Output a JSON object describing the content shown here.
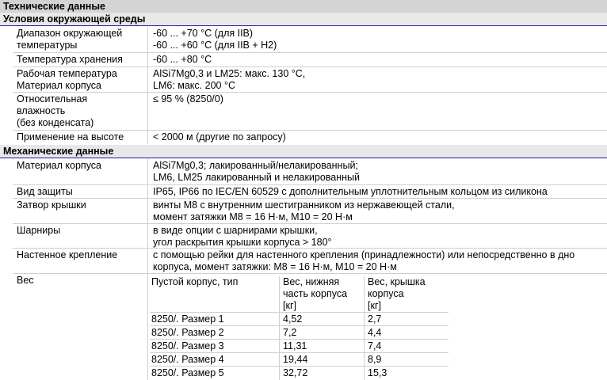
{
  "title": "Технические данные",
  "sections": {
    "env": {
      "header": "Условия окружающей среды",
      "rows": [
        {
          "label": [
            "Диапазон окружающей",
            "температуры"
          ],
          "value": [
            "-60 ... +70 °C (для IIB)",
            "-60 ... +60 °C (для IIB + H2)"
          ]
        },
        {
          "label": [
            "Температура хранения"
          ],
          "value": [
            "-60 ... +80 °C"
          ]
        },
        {
          "label": [
            "Рабочая температура",
            "Материал корпуса"
          ],
          "value": [
            "AlSi7Mg0,3 и LM25: макс. 130 °C,",
            "LM6: макс. 200 °C"
          ]
        },
        {
          "label": [
            "Относительная",
            "влажность",
            "(без конденсата)"
          ],
          "value": [
            "≤ 95 % (8250/0)"
          ]
        },
        {
          "label": [
            "Применение на высоте"
          ],
          "value": [
            "< 2000 м (другие по запросу)"
          ]
        }
      ]
    },
    "mech": {
      "header": "Механические данные",
      "rows": [
        {
          "label": [
            "Материал корпуса"
          ],
          "value": [
            "AlSi7Mg0,3; лакированный/нелакированный;",
            "LM6, LM25 лакированный и нелакированный"
          ]
        },
        {
          "label": [
            "Вид защиты"
          ],
          "value": [
            "IP65, IP66 по IEC/EN 60529 с дополнительным уплотнительным кольцом из силикона"
          ]
        },
        {
          "label": [
            "Затвор крышки"
          ],
          "value": [
            "винты M8 с внутренним шестигранником из нержавеющей стали,",
            "момент затяжки M8 = 16 Н·м, M10 = 20 Н·м"
          ]
        },
        {
          "label": [
            "Шарниры"
          ],
          "value": [
            "в виде опции с шарнирами крышки,",
            "угол раскрытия крышки корпуса > 180°"
          ]
        },
        {
          "label": [
            "Настенное крепление"
          ],
          "value": [
            "с помощью рейки для настенного крепления (принадлежности) или непосредственно в дно",
            "корпуса, момент затяжки: M8 = 16 Н·м, M10 = 20 Н·м"
          ]
        },
        {
          "label": [
            "Вес"
          ],
          "value": []
        }
      ]
    }
  },
  "weight_table": {
    "headers": [
      [
        "Пустой корпус, тип"
      ],
      [
        "Вес, нижняя",
        "часть корпуса",
        "[кг]"
      ],
      [
        "Вес, крышка",
        "корпуса",
        "[кг]"
      ]
    ],
    "rows": [
      [
        "8250/. Размер 1",
        "4,52",
        "2,7"
      ],
      [
        "8250/. Размер 2",
        "7,2",
        "4,4"
      ],
      [
        "8250/. Размер 3",
        "11,31",
        "7,4"
      ],
      [
        "8250/. Размер 4",
        "19,44",
        "8,9"
      ],
      [
        "8250/. Размер 5",
        "32,72",
        "15,3"
      ]
    ]
  }
}
